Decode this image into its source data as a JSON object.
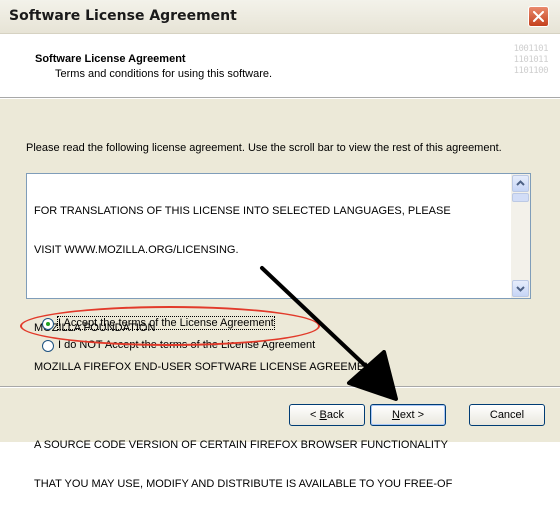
{
  "window": {
    "title": "Software License Agreement"
  },
  "header": {
    "title": "Software License Agreement",
    "subtitle": "Terms and conditions for using this software.",
    "decoration": [
      "1001101",
      "1101011",
      "1101100"
    ]
  },
  "intro_text": "Please read the following license agreement. Use the scroll bar to view the rest of this agreement.",
  "license": {
    "lines": [
      "FOR TRANSLATIONS OF THIS LICENSE INTO SELECTED LANGUAGES, PLEASE",
      "VISIT WWW.MOZILLA.ORG/LICENSING.",
      "",
      "MOZILLA FOUNDATION",
      "MOZILLA FIREFOX END-USER SOFTWARE LICENSE AGREEMENT",
      "",
      "A SOURCE CODE VERSION OF CERTAIN FIREFOX BROWSER FUNCTIONALITY",
      "THAT YOU MAY USE, MODIFY AND DISTRIBUTE IS AVAILABLE TO YOU FREE-OF"
    ]
  },
  "options": {
    "accept_label": "I Accept the terms of the License Agreement",
    "decline_label": "I do NOT Accept the terms of the License Agreement",
    "selected": "accept"
  },
  "buttons": {
    "back_prefix": "< ",
    "back_key": "B",
    "back_rest": "ack",
    "next_key": "N",
    "next_rest": "ext >",
    "cancel": "Cancel"
  },
  "colors": {
    "annotation_ellipse": "#e23a2a",
    "annotation_arrow": "#000000",
    "radio_selected": "#21a121"
  }
}
